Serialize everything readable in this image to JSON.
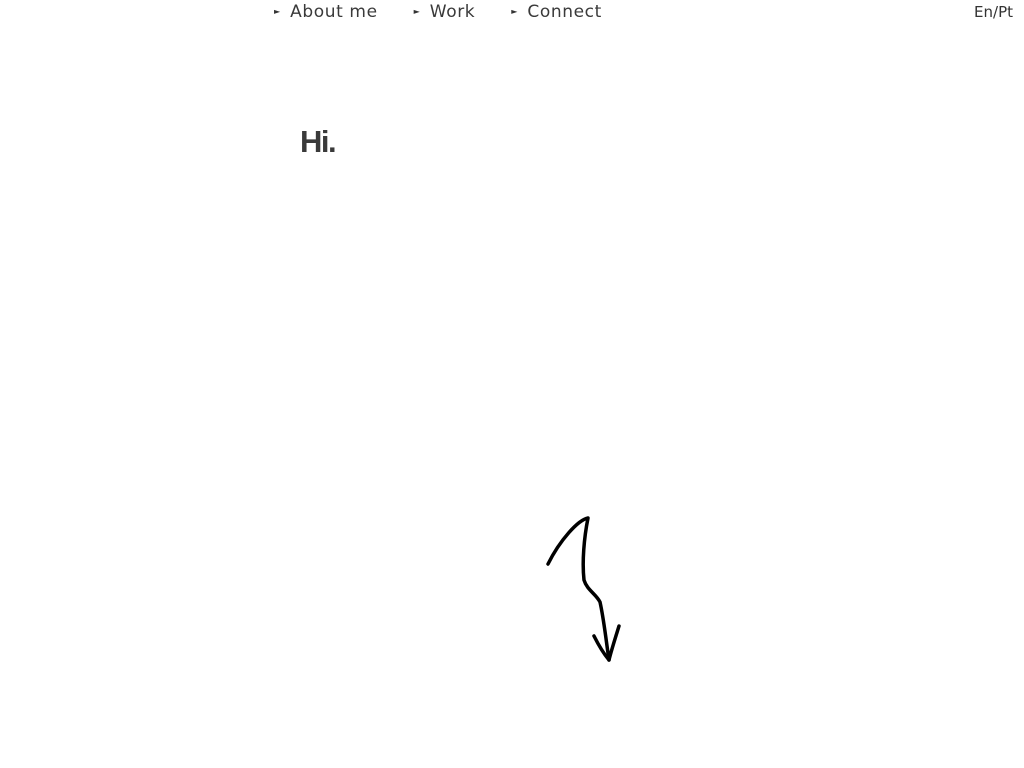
{
  "nav": {
    "items": [
      {
        "label": "About me",
        "icon": "triangle-right-icon"
      },
      {
        "label": "Work",
        "icon": "triangle-right-icon"
      },
      {
        "label": "Connect",
        "icon": "triangle-right-icon"
      }
    ]
  },
  "language_toggle": {
    "label": "En/Pt"
  },
  "hero": {
    "greeting": "Hi."
  },
  "scroll_indicator": {
    "icon": "squiggle-arrow-down-icon"
  }
}
